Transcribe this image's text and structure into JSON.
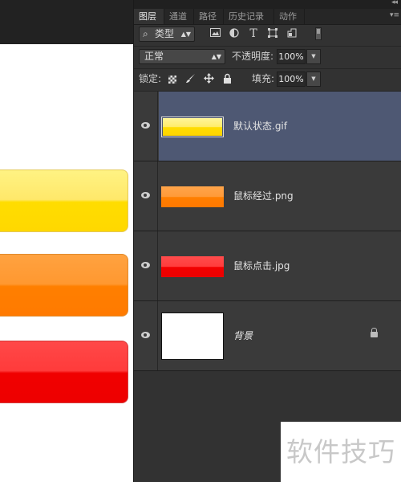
{
  "panel": {
    "collapse_glyph": "◂◂",
    "close_glyph": "✕",
    "menu_glyph": "▾≡",
    "tabs": [
      {
        "label": "图层"
      },
      {
        "label": "通道"
      },
      {
        "label": "路径"
      },
      {
        "label": "历史记录"
      },
      {
        "label": "动作"
      }
    ],
    "filter": {
      "kind_label": "类型",
      "icons": [
        "image-filter-icon",
        "adjustment-filter-icon",
        "type-filter-icon",
        "shape-filter-icon",
        "smart-object-filter-icon",
        "filter-toggle-icon"
      ]
    },
    "blend": {
      "mode": "正常",
      "opacity_label": "不透明度:",
      "opacity_value": "100%"
    },
    "lock": {
      "label": "锁定:",
      "fill_label": "填充:",
      "fill_value": "100%"
    },
    "layers": [
      {
        "name": "默认状态.gif",
        "selected": true,
        "thumb": "yellow"
      },
      {
        "name": "鼠标经过.png",
        "selected": false,
        "thumb": "orange"
      },
      {
        "name": "鼠标点击.jpg",
        "selected": false,
        "thumb": "red"
      },
      {
        "name": "背景",
        "selected": false,
        "thumb": "white",
        "locked": true
      }
    ]
  },
  "watermark": "软件技巧",
  "colors": {
    "panel_bg": "#323232",
    "selected_layer": "#4e5873",
    "button_yellow": "#ffdd00",
    "button_orange": "#ff7f00",
    "button_red": "#f00000"
  }
}
